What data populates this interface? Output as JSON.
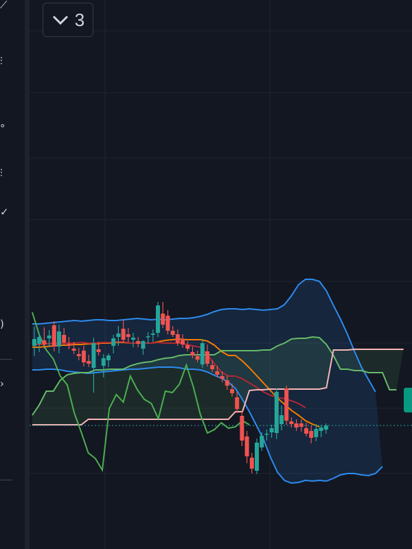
{
  "indicator_toggle": {
    "icon": "chevron-down-icon",
    "count": "3"
  },
  "left_toolbar": {
    "icons": [
      "trend-line-icon",
      "fib-icon",
      "brush-icon",
      "text-icon",
      "measure-icon",
      "magnet-icon",
      "zoom-icon"
    ]
  },
  "colors": {
    "background": "#131722",
    "grid": "#1f2433",
    "bull": "#26a69a",
    "bear": "#ef5350",
    "bollinger": "#2d8cf0",
    "ma_orange": "#f57c00",
    "ma_darkred": "#b22833",
    "cloud_green": "#66bb6a",
    "cloud_pink": "#f7b7b7",
    "lagging": "#4caf50",
    "last_price_line": "#26a69a"
  },
  "chart_data": {
    "type": "candlestick",
    "title": "",
    "xlabel": "",
    "ylabel": "",
    "ylim": [
      0,
      800
    ],
    "grid": true,
    "candles": [
      {
        "o": 296,
        "h": 324,
        "l": 281,
        "c": 306
      },
      {
        "o": 299,
        "h": 314,
        "l": 287,
        "c": 309
      },
      {
        "o": 304,
        "h": 323,
        "l": 292,
        "c": 298
      },
      {
        "o": 307,
        "h": 319,
        "l": 295,
        "c": 311
      },
      {
        "o": 326,
        "h": 332,
        "l": 288,
        "c": 295
      },
      {
        "o": 295,
        "h": 327,
        "l": 285,
        "c": 317
      },
      {
        "o": 312,
        "h": 322,
        "l": 298,
        "c": 301
      },
      {
        "o": 299,
        "h": 309,
        "l": 291,
        "c": 296
      },
      {
        "o": 292,
        "h": 302,
        "l": 284,
        "c": 289
      },
      {
        "o": 284,
        "h": 293,
        "l": 275,
        "c": 281
      },
      {
        "o": 289,
        "h": 296,
        "l": 266,
        "c": 272
      },
      {
        "o": 274,
        "h": 283,
        "l": 265,
        "c": 270
      },
      {
        "o": 264,
        "h": 308,
        "l": 228,
        "c": 300
      },
      {
        "o": 291,
        "h": 302,
        "l": 282,
        "c": 287
      },
      {
        "o": 267,
        "h": 284,
        "l": 250,
        "c": 278
      },
      {
        "o": 275,
        "h": 285,
        "l": 265,
        "c": 282
      },
      {
        "o": 296,
        "h": 312,
        "l": 285,
        "c": 307
      },
      {
        "o": 309,
        "h": 325,
        "l": 296,
        "c": 314
      },
      {
        "o": 321,
        "h": 334,
        "l": 300,
        "c": 305
      },
      {
        "o": 313,
        "h": 322,
        "l": 301,
        "c": 309
      },
      {
        "o": 305,
        "h": 315,
        "l": 294,
        "c": 308
      },
      {
        "o": 303,
        "h": 309,
        "l": 294,
        "c": 299
      },
      {
        "o": 292,
        "h": 304,
        "l": 283,
        "c": 303
      },
      {
        "o": 309,
        "h": 316,
        "l": 299,
        "c": 310
      },
      {
        "o": 312,
        "h": 320,
        "l": 302,
        "c": 314
      },
      {
        "o": 315,
        "h": 360,
        "l": 309,
        "c": 355
      },
      {
        "o": 343,
        "h": 360,
        "l": 322,
        "c": 327
      },
      {
        "o": 340,
        "h": 348,
        "l": 313,
        "c": 318
      },
      {
        "o": 318,
        "h": 325,
        "l": 309,
        "c": 312
      },
      {
        "o": 313,
        "h": 320,
        "l": 296,
        "c": 300
      },
      {
        "o": 306,
        "h": 313,
        "l": 293,
        "c": 298
      },
      {
        "o": 297,
        "h": 303,
        "l": 288,
        "c": 292
      },
      {
        "o": 287,
        "h": 295,
        "l": 278,
        "c": 282
      },
      {
        "o": 281,
        "h": 289,
        "l": 272,
        "c": 276
      },
      {
        "o": 269,
        "h": 306,
        "l": 264,
        "c": 300
      },
      {
        "o": 288,
        "h": 298,
        "l": 266,
        "c": 270
      },
      {
        "o": 268,
        "h": 275,
        "l": 258,
        "c": 262
      },
      {
        "o": 259,
        "h": 267,
        "l": 250,
        "c": 254
      },
      {
        "o": 252,
        "h": 259,
        "l": 243,
        "c": 248
      },
      {
        "o": 246,
        "h": 253,
        "l": 232,
        "c": 238
      },
      {
        "o": 233,
        "h": 241,
        "l": 222,
        "c": 227
      },
      {
        "o": 221,
        "h": 229,
        "l": 198,
        "c": 204
      },
      {
        "o": 194,
        "h": 202,
        "l": 150,
        "c": 158
      },
      {
        "o": 164,
        "h": 172,
        "l": 125,
        "c": 135
      },
      {
        "o": 133,
        "h": 140,
        "l": 110,
        "c": 117
      },
      {
        "o": 114,
        "h": 161,
        "l": 109,
        "c": 155
      },
      {
        "o": 148,
        "h": 170,
        "l": 143,
        "c": 165
      },
      {
        "o": 167,
        "h": 174,
        "l": 158,
        "c": 168
      },
      {
        "o": 170,
        "h": 181,
        "l": 162,
        "c": 176
      },
      {
        "o": 169,
        "h": 234,
        "l": 160,
        "c": 229
      },
      {
        "o": 182,
        "h": 209,
        "l": 173,
        "c": 195
      },
      {
        "o": 234,
        "h": 238,
        "l": 181,
        "c": 187
      },
      {
        "o": 186,
        "h": 192,
        "l": 177,
        "c": 182
      },
      {
        "o": 183,
        "h": 189,
        "l": 172,
        "c": 177
      },
      {
        "o": 183,
        "h": 189,
        "l": 171,
        "c": 178
      },
      {
        "o": 176,
        "h": 184,
        "l": 164,
        "c": 168
      },
      {
        "o": 172,
        "h": 180,
        "l": 154,
        "c": 162
      },
      {
        "o": 163,
        "h": 182,
        "l": 157,
        "c": 175
      },
      {
        "o": 172,
        "h": 181,
        "l": 163,
        "c": 177
      },
      {
        "o": 174,
        "h": 183,
        "l": 168,
        "c": 180
      }
    ],
    "series": [
      {
        "key": "bb_upper",
        "color": "#2d8cf0",
        "values": [
          328,
          328,
          329,
          330,
          331,
          332,
          333,
          332,
          333,
          334,
          334,
          333,
          333,
          334,
          335,
          336,
          335,
          334,
          335,
          334,
          335,
          336,
          336,
          337,
          339,
          342,
          346,
          349,
          350,
          350,
          349,
          350,
          349,
          348,
          349,
          350,
          356,
          369,
          385,
          393,
          393,
          390,
          376,
          355,
          335,
          313,
          288,
          265,
          247,
          229
        ]
      },
      {
        "key": "bb_lower",
        "color": "#2d8cf0",
        "values": [
          261,
          261,
          262,
          262,
          261,
          259,
          258,
          257,
          256,
          257,
          258,
          259,
          260,
          261,
          262,
          262,
          263,
          264,
          265,
          265,
          265,
          264,
          262,
          262,
          261,
          258,
          253,
          249,
          243,
          234,
          218,
          200,
          180,
          160,
          134,
          112,
          100,
          96,
          97,
          100,
          99,
          100,
          99,
          103,
          108,
          110,
          110,
          108,
          107,
          110,
          120
        ]
      },
      {
        "key": "ma_orange",
        "color": "#f57c00",
        "values": [
          294,
          294,
          295,
          296,
          297,
          297,
          298,
          298,
          299,
          299,
          300,
          300,
          301,
          301,
          300,
          300,
          300,
          300,
          302,
          304,
          305,
          306,
          305,
          305,
          305,
          303,
          297,
          288,
          282,
          282,
          274,
          264,
          253,
          242,
          231,
          220,
          211,
          202,
          195,
          187,
          182,
          178
        ]
      },
      {
        "key": "ma_darkred",
        "color": "#b22833",
        "values": [
          298,
          298,
          299,
          300,
          300,
          300,
          300,
          301,
          300,
          300,
          301,
          301,
          302,
          302,
          300,
          300,
          300,
          300,
          301,
          300,
          300,
          300,
          298,
          296,
          294,
          283,
          270,
          258,
          252,
          252,
          248,
          242,
          236,
          229,
          224,
          221,
          219,
          216,
          212,
          206
        ]
      },
      {
        "key": "cloud_green",
        "color": "#66bb6a",
        "values": [
          195,
          210,
          230,
          230,
          246,
          254,
          256,
          257,
          257,
          261,
          261,
          262,
          262,
          262,
          267,
          270,
          272,
          273,
          276,
          278,
          279,
          282,
          283,
          283,
          283,
          283,
          283,
          289,
          289,
          289,
          289,
          289,
          289,
          290,
          290,
          296,
          300,
          306,
          307,
          307,
          309,
          308,
          298,
          282,
          262,
          262,
          260,
          260,
          257,
          257,
          257,
          232,
          232
        ]
      },
      {
        "key": "cloud_pink",
        "color": "#f7b7b7",
        "values": [
          181,
          181,
          181,
          181,
          181,
          181,
          181,
          181,
          189,
          189,
          189,
          189,
          189,
          189,
          189,
          189,
          189,
          189,
          189,
          189,
          189,
          189,
          189,
          189,
          189,
          189,
          189,
          189,
          189,
          200,
          200,
          231,
          232,
          232,
          233,
          233,
          233,
          233,
          233,
          233,
          233,
          233,
          235,
          290,
          290,
          290,
          291,
          291,
          291,
          291,
          291,
          291,
          291,
          291
        ]
      },
      {
        "key": "lagging",
        "color": "#4caf50",
        "values": [
          345,
          312,
          290,
          277,
          252,
          239,
          198,
          170,
          140,
          132,
          115,
          205,
          225,
          214,
          252,
          232,
          218,
          212,
          190,
          230,
          228,
          240,
          268,
          236,
          196,
          169,
          174,
          184,
          176,
          178,
          187,
          181
        ]
      }
    ],
    "last_price": 180
  }
}
